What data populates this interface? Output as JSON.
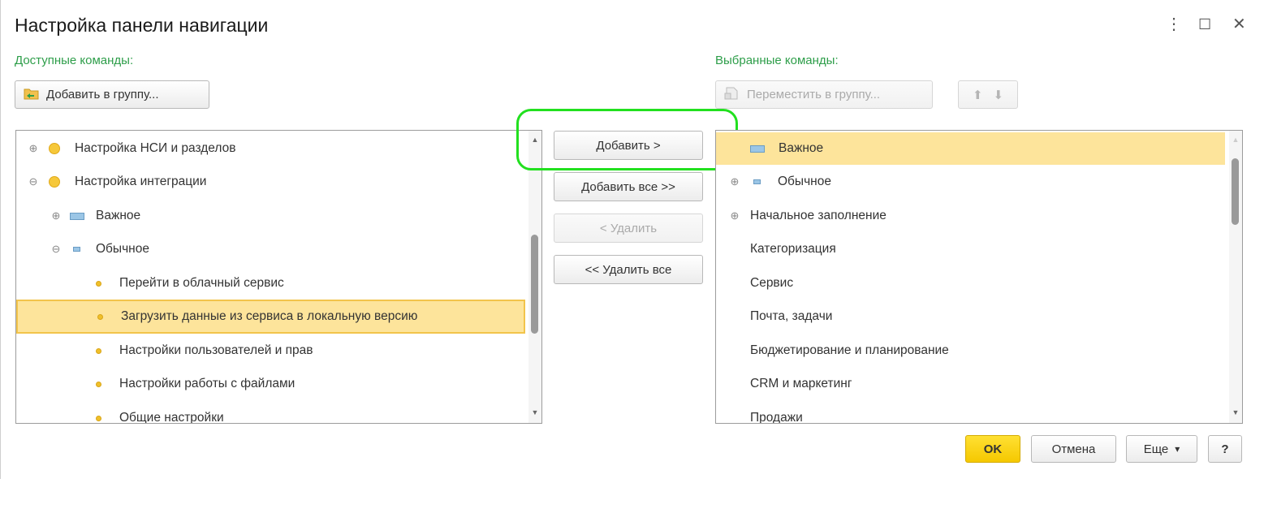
{
  "window": {
    "title": "Настройка панели навигации",
    "menu_icon": "⋮",
    "maximize_icon": "☐",
    "close_icon": "✕"
  },
  "left": {
    "label": "Доступные команды:",
    "add_to_group_label": "Добавить в группу...",
    "items": [
      {
        "label": "Настройка НСИ и разделов",
        "expander": "⊕",
        "icon": "circle-big"
      },
      {
        "label": "Настройка интеграции",
        "expander": "⊖",
        "icon": "circle-big"
      },
      {
        "label": "Важное",
        "expander": "⊕",
        "icon": "rect-big"
      },
      {
        "label": "Обычное",
        "expander": "⊖",
        "icon": "rect-small"
      },
      {
        "label": "Перейти в облачный сервис",
        "icon": "circle-small"
      },
      {
        "label": "Загрузить данные из сервиса в локальную версию",
        "icon": "circle-small",
        "selected": true
      },
      {
        "label": "Настройки пользователей и прав",
        "icon": "circle-small"
      },
      {
        "label": "Настройки работы с файлами",
        "icon": "circle-small"
      },
      {
        "label": "Общие настройки",
        "icon": "circle-small"
      }
    ]
  },
  "middle": {
    "add_label": "Добавить >",
    "add_all_label": "Добавить все >>",
    "remove_label": "< Удалить",
    "remove_all_label": "<< Удалить все"
  },
  "right": {
    "label": "Выбранные команды:",
    "move_to_group_label": "Переместить в группу...",
    "up_icon": "⬆",
    "down_icon": "⬇",
    "items": [
      {
        "label": "Важное",
        "icon": "rect-big",
        "selected": true
      },
      {
        "label": "Обычное",
        "expander": "⊕",
        "icon": "rect-small"
      },
      {
        "label": "Начальное заполнение",
        "expander": "⊕"
      },
      {
        "label": "Категоризация"
      },
      {
        "label": "Сервис"
      },
      {
        "label": "Почта, задачи"
      },
      {
        "label": "Бюджетирование и планирование"
      },
      {
        "label": "CRM и маркетинг"
      },
      {
        "label": "Продажи"
      }
    ]
  },
  "footer": {
    "ok_label": "OK",
    "cancel_label": "Отмена",
    "more_label": "Еще",
    "more_caret": "▾",
    "help_label": "?"
  },
  "colors": {
    "accent_green": "#2e9e4a",
    "selection": "#fde49b",
    "highlight": "#22e01f",
    "ok_button": "#f5c800"
  }
}
